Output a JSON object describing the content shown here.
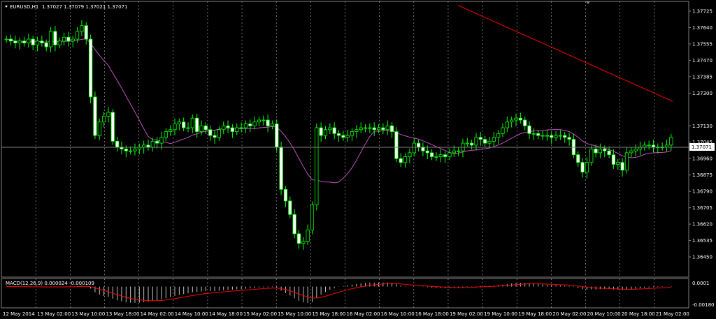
{
  "header": {
    "symbol_label": "EURUSD,H1",
    "ohlc_label": "1.37027 1.37079 1.37021 1.37071"
  },
  "macd": {
    "legend_label": "MACD(12,26,9) 0.000024 -0.000109",
    "axis_top": "0.0001",
    "axis_bottom": "-0.00180"
  },
  "price_axis": {
    "ticks": [
      "1.37725",
      "1.37640",
      "1.37555",
      "1.37470",
      "1.37385",
      "1.37300",
      "1.37130",
      "1.37045",
      "1.36960",
      "1.36875",
      "1.36790",
      "1.36705",
      "1.36620",
      "1.36535",
      "1.36450"
    ],
    "current_price": "1.37071"
  },
  "time_axis": {
    "labels": [
      "12 May 2014",
      "13 May 02:00",
      "13 May 10:00",
      "13 May 18:00",
      "14 May 02:00",
      "14 May 10:00",
      "14 May 18:00",
      "15 May 02:00",
      "15 May 10:00",
      "15 May 18:00",
      "16 May 02:00",
      "16 May 10:00",
      "16 May 18:00",
      "19 May 02:00",
      "19 May 10:00",
      "19 May 18:00",
      "20 May 02:00",
      "20 May 10:00",
      "20 May 18:00",
      "21 May 02:00"
    ]
  },
  "colors": {
    "background": "#000000",
    "candle_up_fill": "#000000",
    "candle_up_stroke": "#00ff00",
    "candle_down_fill": "#ffffff",
    "candle_down_stroke": "#00ff00",
    "ma_slow": "#ff0000",
    "ma_fast": "#c050c0",
    "grid": "#ffffff",
    "axis_text": "#ffffff",
    "macd_hist": "#c0c0c0",
    "macd_signal": "#ff0000"
  },
  "chart_data": {
    "type": "candlestick",
    "symbol": "EURUSD",
    "timeframe": "H1",
    "ylim": [
      1.3645,
      1.37725
    ],
    "closes": [
      1.3758,
      1.3757,
      1.3756,
      1.3757,
      1.3756,
      1.3758,
      1.3755,
      1.3757,
      1.3756,
      1.3754,
      1.3762,
      1.3755,
      1.3757,
      1.3759,
      1.3757,
      1.3758,
      1.3762,
      1.3765,
      1.3758,
      1.3728,
      1.3708,
      1.3715,
      1.3718,
      1.372,
      1.3705,
      1.3702,
      1.3701,
      1.37,
      1.37,
      1.3701,
      1.3702,
      1.3703,
      1.3702,
      1.3705,
      1.3704,
      1.3707,
      1.371,
      1.3711,
      1.3714,
      1.3715,
      1.3712,
      1.3712,
      1.3717,
      1.371,
      1.3713,
      1.3711,
      1.3708,
      1.3707,
      1.3711,
      1.3713,
      1.3712,
      1.371,
      1.3712,
      1.3712,
      1.3714,
      1.3713,
      1.3715,
      1.3716,
      1.3716,
      1.3713,
      1.3714,
      1.3702,
      1.368,
      1.3674,
      1.3667,
      1.3657,
      1.3652,
      1.3653,
      1.3659,
      1.3672,
      1.3712,
      1.3708,
      1.3711,
      1.3712,
      1.3709,
      1.3708,
      1.3707,
      1.3708,
      1.371,
      1.3711,
      1.3712,
      1.3712,
      1.3712,
      1.3711,
      1.3712,
      1.3711,
      1.3713,
      1.371,
      1.3696,
      1.3694,
      1.3697,
      1.3699,
      1.3704,
      1.3702,
      1.37,
      1.3699,
      1.3697,
      1.3697,
      1.3698,
      1.3697,
      1.3699,
      1.37,
      1.37,
      1.3704,
      1.3704,
      1.3703,
      1.3707,
      1.3706,
      1.3704,
      1.3705,
      1.3707,
      1.3709,
      1.3712,
      1.3715,
      1.3716,
      1.3717,
      1.3716,
      1.3713,
      1.3709,
      1.3709,
      1.3708,
      1.3708,
      1.3708,
      1.3707,
      1.3708,
      1.3708,
      1.3707,
      1.3706,
      1.3698,
      1.3694,
      1.3689,
      1.3694,
      1.3701,
      1.3699,
      1.3701,
      1.37,
      1.3698,
      1.3693,
      1.3694,
      1.369,
      1.3699,
      1.37,
      1.3701,
      1.3702,
      1.3703,
      1.3703,
      1.3702,
      1.3702,
      1.3702,
      1.3703,
      1.3707
    ]
  }
}
